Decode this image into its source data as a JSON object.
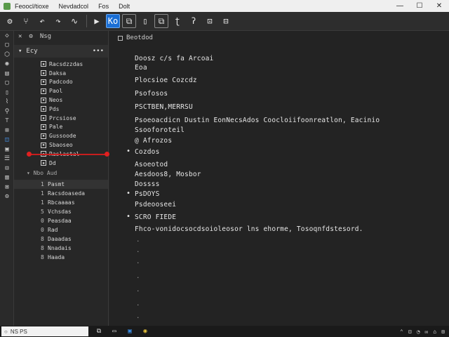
{
  "titlebar": {
    "menus": [
      "Feoocl/tioxe",
      "Nevdadcol",
      "Fos",
      "Dolt"
    ],
    "controls": [
      "—",
      "☐",
      "✕"
    ]
  },
  "toolbar": {
    "icons": [
      "gear-icon",
      "branch-icon",
      "undo-icon",
      "redo-icon",
      "wave-icon",
      "run-icon",
      "active-view-icon",
      "split-icon",
      "file-icon",
      "copy-icon",
      "tool-icon",
      "phone-icon",
      "camera-icon",
      "capture-icon"
    ],
    "active_label": "Ko",
    "glyphs": [
      "⚙",
      "⑂",
      "↶",
      "↷",
      "∿",
      "▶",
      "Ko",
      "⧉",
      "▯",
      "⧉",
      "ʈ",
      "ʔ",
      "⊡",
      "⊟"
    ]
  },
  "activity_icons": [
    "◇",
    "▢",
    "⬡",
    "◉",
    "▤",
    "▢",
    "▯",
    "⌇",
    "⚲",
    "⊤",
    "⊞",
    "◫",
    "▣",
    "☰",
    "⊟",
    "▥",
    "⊠",
    "⚙"
  ],
  "sidebar": {
    "toolbar": [
      "✕",
      "⚙",
      "Nsg"
    ],
    "head_label": "Ecy",
    "tree": [
      "Racsdzzdas",
      "Daksa",
      "Padcodo",
      "Paol",
      "Neos",
      "Pds",
      "Prcsiose",
      "Pale",
      "Gussoode",
      "Sbaoseo",
      "Raslastal",
      "Dd"
    ],
    "section2": "Nbo Aud",
    "list": [
      {
        "num": "1",
        "label": "Pasmt"
      },
      {
        "num": "1",
        "label": "Racsdoaseda"
      },
      {
        "num": "1",
        "label": "Rbcaaaas"
      },
      {
        "num": "5",
        "label": "Vchsdas"
      },
      {
        "num": "0",
        "label": "Peasdaa"
      },
      {
        "num": "0",
        "label": "Rad"
      },
      {
        "num": "8",
        "label": "Daaadas"
      },
      {
        "num": "8",
        "label": "Nnadais"
      },
      {
        "num": "8",
        "label": "Haada"
      }
    ]
  },
  "editor": {
    "tab_label": "Beotdod",
    "lines": [
      "Doosz c/s fa Arcoai",
      "Eoa",
      "Plocsioe Cozcdz",
      "Psofosos",
      "PSCTBEN,MERRSU",
      "Psoeoacdicn Dustin EonNecsAdos Coocloiifoonreatlon, Eacinio",
      "Ssooforoteil",
      "@ Afrozos",
      "Cozdos",
      "Asoeotod",
      "Aesdoos8, Mosbor",
      "Dossss",
      "PsDOYS",
      "Psdeooseei",
      "SCRO FIEDE",
      "Fhco-vonidocsocdsoioleosor lns ehorme, Tosoqnfdstesord."
    ],
    "bullets": [
      8,
      12,
      14
    ]
  },
  "taskbar": {
    "search": "NS PS",
    "tray": [
      "⌃",
      "⊡",
      "◔",
      "✉",
      "⌂",
      "⊞"
    ]
  }
}
